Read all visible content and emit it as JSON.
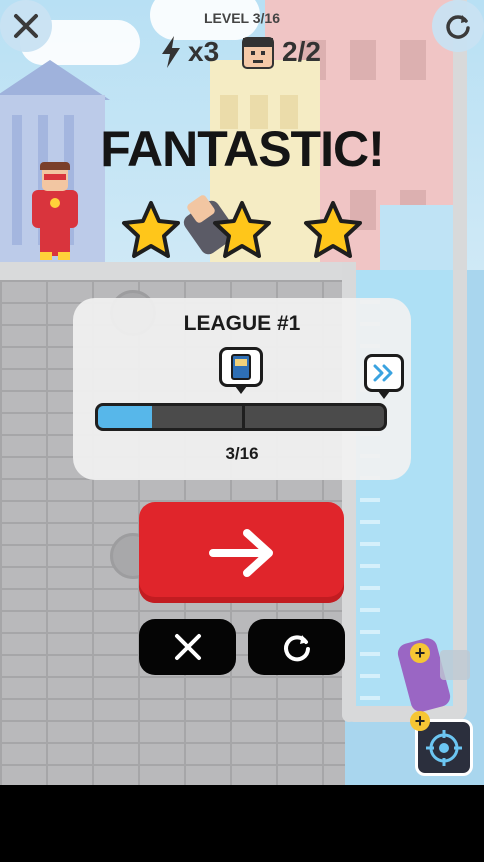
{
  "hud": {
    "level": "LEVEL 3/16",
    "energy": "x3",
    "targets": "2/2"
  },
  "result": {
    "title": "FANTASTIC!",
    "stars_earned": 3,
    "stars_total": 3
  },
  "league": {
    "title": "LEAGUE #1",
    "progress_text": "3/16",
    "progress_fraction": 0.1875
  },
  "icons": {
    "close": "close-icon",
    "restart": "restart-icon",
    "energy": "lightning-icon",
    "target_face": "enemy-face-icon",
    "reward": "book-icon",
    "skip": "double-chevron-icon",
    "next": "arrow-right-icon",
    "dismiss": "x-icon",
    "retry": "retry-icon",
    "aim": "crosshair-icon",
    "add": "plus-icon"
  },
  "colors": {
    "next_button": "#e0252b",
    "progress_fill": "#57b7ea",
    "star": "#ffc61a"
  }
}
